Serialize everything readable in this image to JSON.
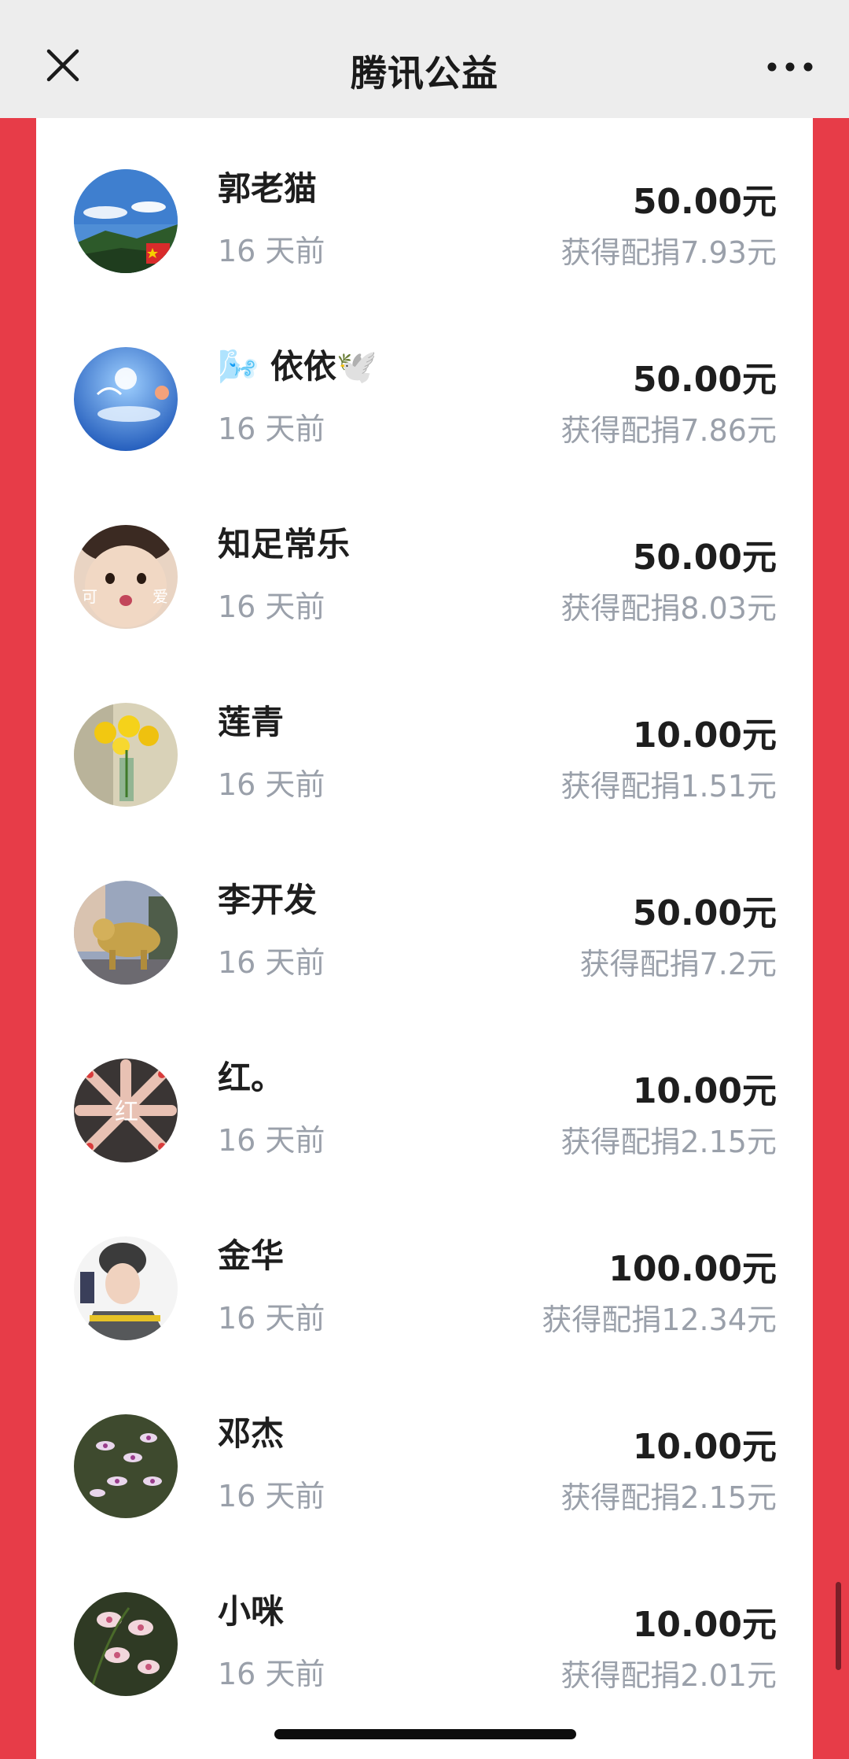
{
  "app": {
    "title": "腾讯公益",
    "close_icon": "close-icon",
    "more_icon": "more-dots-icon"
  },
  "donations": [
    {
      "name": "郭老猫",
      "time": "16 天前",
      "amount": "50.00元",
      "match": "获得配捐7.93元"
    },
    {
      "name": "🌬️ 依依🕊️",
      "time": "16 天前",
      "amount": "50.00元",
      "match": "获得配捐7.86元"
    },
    {
      "name": "知足常乐",
      "time": "16 天前",
      "amount": "50.00元",
      "match": "获得配捐8.03元"
    },
    {
      "name": "莲青",
      "time": "16 天前",
      "amount": "10.00元",
      "match": "获得配捐1.51元"
    },
    {
      "name": "李开发",
      "time": "16 天前",
      "amount": "50.00元",
      "match": "获得配捐7.2元"
    },
    {
      "name": "红。",
      "time": "16 天前",
      "amount": "10.00元",
      "match": "获得配捐2.15元"
    },
    {
      "name": "金华",
      "time": "16 天前",
      "amount": "100.00元",
      "match": "获得配捐12.34元"
    },
    {
      "name": "邓杰",
      "time": "16 天前",
      "amount": "10.00元",
      "match": "获得配捐2.15元"
    },
    {
      "name": "小咪",
      "time": "16 天前",
      "amount": "10.00元",
      "match": "获得配捐2.01元"
    }
  ],
  "avatar_labels": {
    "row3_left": "可",
    "row3_right": "爱",
    "row6": "红"
  },
  "colors": {
    "background_red": "#e73c48",
    "topbar": "#ededed",
    "panel": "#ffffff",
    "text_primary": "#1e1e1e",
    "text_secondary": "#9aa0aa"
  }
}
